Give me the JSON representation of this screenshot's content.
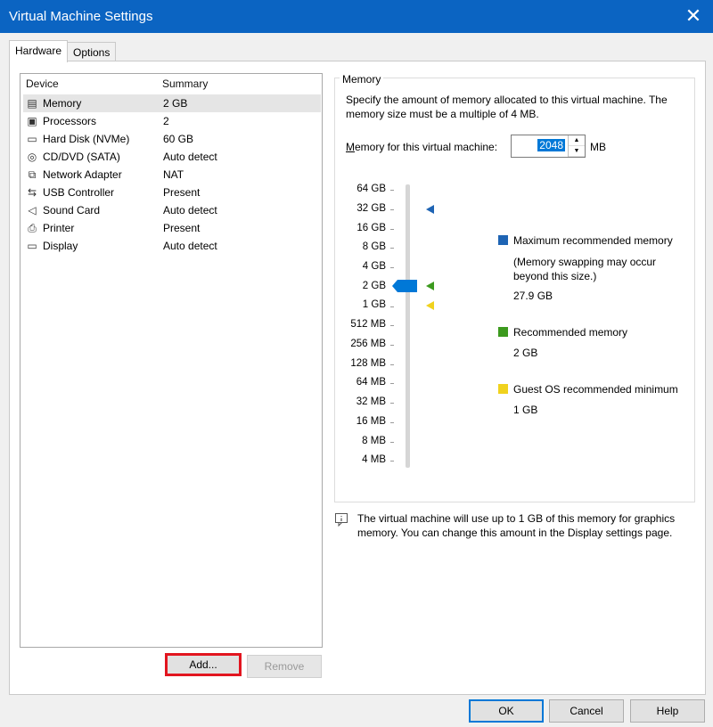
{
  "window": {
    "title": "Virtual Machine Settings",
    "close_glyph": "✕"
  },
  "tabs": [
    {
      "label": "Hardware"
    },
    {
      "label": "Options"
    }
  ],
  "device_list": {
    "headers": {
      "device": "Device",
      "summary": "Summary"
    },
    "rows": [
      {
        "device": "Memory",
        "summary": "2 GB",
        "icon": "memory-icon",
        "glyph": "▤"
      },
      {
        "device": "Processors",
        "summary": "2",
        "icon": "processor-icon",
        "glyph": "▣"
      },
      {
        "device": "Hard Disk (NVMe)",
        "summary": "60 GB",
        "icon": "hard-disk-icon",
        "glyph": "▭"
      },
      {
        "device": "CD/DVD (SATA)",
        "summary": "Auto detect",
        "icon": "cd-dvd-icon",
        "glyph": "◎"
      },
      {
        "device": "Network Adapter",
        "summary": "NAT",
        "icon": "network-adapter-icon",
        "glyph": "⧉"
      },
      {
        "device": "USB Controller",
        "summary": "Present",
        "icon": "usb-icon",
        "glyph": "⇆"
      },
      {
        "device": "Sound Card",
        "summary": "Auto detect",
        "icon": "speaker-icon",
        "glyph": "◁"
      },
      {
        "device": "Printer",
        "summary": "Present",
        "icon": "printer-icon",
        "glyph": "⎙"
      },
      {
        "device": "Display",
        "summary": "Auto detect",
        "icon": "monitor-icon",
        "glyph": "▭"
      }
    ]
  },
  "list_buttons": {
    "add": "Add...",
    "remove": "Remove"
  },
  "memory": {
    "group_label": "Memory",
    "description": "Specify the amount of memory allocated to this virtual machine. The memory size must be a multiple of 4 MB.",
    "field_label_accel": "M",
    "field_label_rest": "emory for this virtual machine:",
    "value": "2048",
    "unit": "MB",
    "slider_ticks": [
      "64 GB",
      "32 GB",
      "16 GB",
      "8 GB",
      "4 GB",
      "2 GB",
      "1 GB",
      "512 MB",
      "256 MB",
      "128 MB",
      "64 MB",
      "32 MB",
      "16 MB",
      "8 MB",
      "4 MB"
    ],
    "legend": {
      "max": {
        "title": "Maximum recommended memory",
        "note": "(Memory swapping may occur beyond this size.)",
        "value": "27.9 GB",
        "color": "#1e64b4"
      },
      "recommended": {
        "title": "Recommended memory",
        "value": "2 GB",
        "color": "#3c9a1e"
      },
      "guest_min": {
        "title": "Guest OS recommended minimum",
        "value": "1 GB",
        "color": "#f0d21e"
      }
    },
    "info_text": "The virtual machine will use up to 1 GB of this memory for graphics memory. You can change this amount in the Display settings page."
  },
  "footer": {
    "ok": "OK",
    "cancel": "Cancel",
    "help": "Help"
  }
}
